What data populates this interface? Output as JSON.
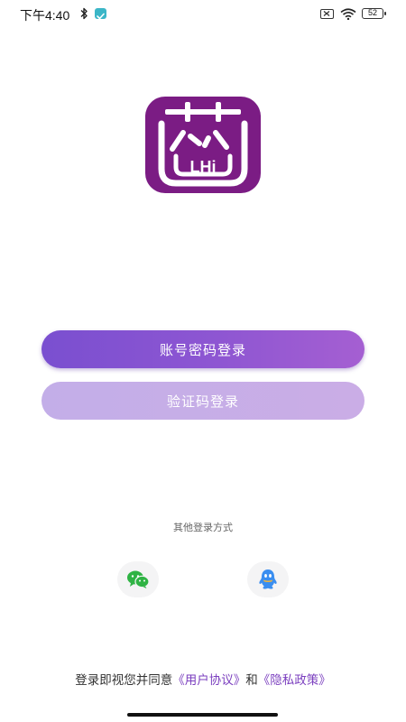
{
  "status_bar": {
    "time": "下午4:40",
    "battery_level": "52",
    "icons": [
      "bluetooth-icon",
      "check-badge-icon",
      "sim-icon",
      "wifi-icon",
      "battery-icon"
    ]
  },
  "logo": {
    "text": "LHi",
    "background_color": "#7b1c84"
  },
  "buttons": {
    "password_login": "账号密码登录",
    "code_login": "验证码登录"
  },
  "other_login": {
    "label": "其他登录方式",
    "providers": [
      "wechat-icon",
      "qq-icon"
    ]
  },
  "agreement": {
    "prefix": "登录即视您并同意",
    "user_agreement": "《用户协议》",
    "conjunction": "和",
    "privacy_policy": "《隐私政策》"
  },
  "colors": {
    "accent": "#8a55d2",
    "accent_light": "#c7aee7",
    "link": "#7b3fbf",
    "wechat": "#2fb344",
    "qq": "#3a8ef0"
  }
}
